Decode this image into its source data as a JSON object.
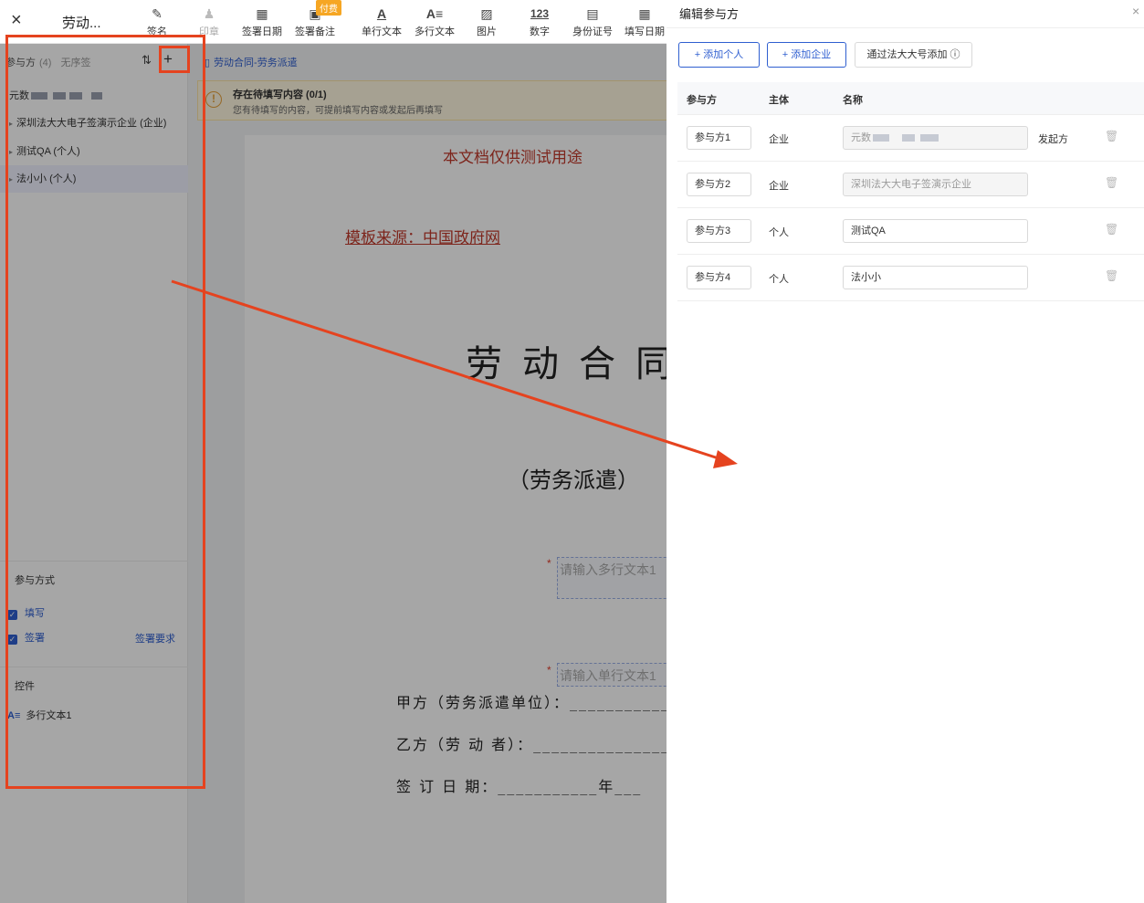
{
  "header": {
    "close_icon": "×",
    "doc_title": "劳动...",
    "paid_badge": "付费",
    "tools": [
      {
        "icon": "✎",
        "label": "签名"
      },
      {
        "icon": "♟",
        "label": "印章"
      },
      {
        "icon": "▦",
        "label": "签署日期"
      },
      {
        "icon": "▣",
        "label": "签署备注"
      },
      {
        "icon": "A",
        "label": "单行文本"
      },
      {
        "icon": "A≡",
        "label": "多行文本"
      },
      {
        "icon": "▨",
        "label": "图片"
      },
      {
        "icon": "123",
        "label": "数字"
      },
      {
        "icon": "▤",
        "label": "身份证号"
      },
      {
        "icon": "▦",
        "label": "填写日期"
      }
    ]
  },
  "left_panel": {
    "title": "参与方",
    "count": "(4)",
    "order_mode": "无序签",
    "sort_icon": "⇅",
    "add_icon": "+",
    "parties": [
      {
        "label": "元数"
      },
      {
        "label": "深圳法大大电子签演示企业 (企业)"
      },
      {
        "label": "测试QA (个人)"
      },
      {
        "label": "法小小 (个人)"
      }
    ],
    "participation_title": "参与方式",
    "check_fill": "填写",
    "check_sign": "签署",
    "sign_requirement": "签署要求",
    "controls_title": "控件",
    "control_icon": "A≡",
    "control_item": "多行文本1"
  },
  "doc": {
    "breadcrumb": "劳动合同-劳务派遣",
    "notice_title": "存在待填写内容 (0/1)",
    "notice_desc": "您有待填写的内容，可提前填写内容或发起后再填写",
    "notice_icon": "!",
    "test_note": "本文档仅供测试用途",
    "source": "模板来源：中国政府网",
    "title": "劳动合同",
    "subtitle": "（劳务派遣）",
    "field_multi_placeholder": "请输入多行文本1",
    "field_single_placeholder": "请输入单行文本1",
    "line_a": "甲方（劳务派遣单位）：____________",
    "line_b": "乙方（劳 动 者）：_________________",
    "line_c": "签  订 日 期：___________年___"
  },
  "drawer": {
    "title": "编辑参与方",
    "close_icon": "×",
    "add_person": "+ 添加个人",
    "add_company": "+ 添加企业",
    "add_by_account": "通过法大大号添加 ⓘ",
    "col_party": "参与方",
    "col_subject": "主体",
    "col_name": "名称",
    "rows": [
      {
        "role": "参与方1",
        "subject": "企业",
        "name": "元数",
        "tag": "发起方"
      },
      {
        "role": "参与方2",
        "subject": "企业",
        "name": "深圳法大大电子签演示企业",
        "tag": ""
      },
      {
        "role": "参与方3",
        "subject": "个人",
        "name": "测试QA",
        "tag": ""
      },
      {
        "role": "参与方4",
        "subject": "个人",
        "name": "法小小",
        "tag": ""
      }
    ],
    "trash_icon": "🗑"
  },
  "colors": {
    "accent": "#2f5fd0",
    "annotation": "#e5431f",
    "doc_red": "#c0392b"
  }
}
